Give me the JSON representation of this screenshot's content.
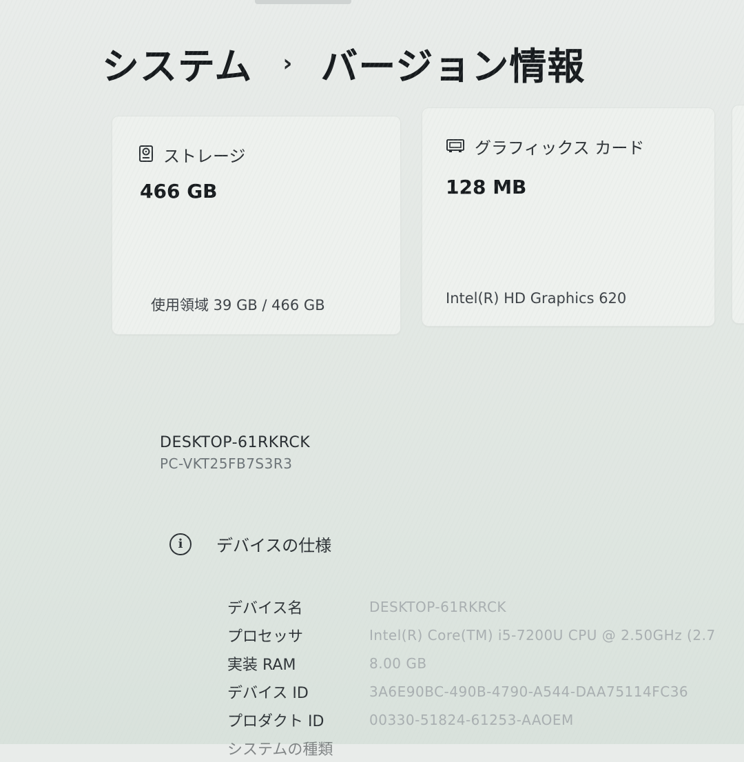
{
  "breadcrumb": {
    "parent": "システム",
    "separator": "›",
    "current": "バージョン情報"
  },
  "cards": {
    "storage": {
      "icon": "hard-drive-icon",
      "title": "ストレージ",
      "value": "466 GB",
      "sub": "使用領域 39 GB / 466 GB"
    },
    "graphics": {
      "icon": "graphics-card-icon",
      "title": "グラフィックス カード",
      "value": "128 MB",
      "sub": "Intel(R) HD Graphics 620"
    }
  },
  "device": {
    "name": "DESKTOP-61RKRCK",
    "model": "PC-VKT25FB7S3R3"
  },
  "specs": {
    "icon": "info-icon",
    "title": "デバイスの仕様",
    "rows": [
      {
        "label": "デバイス名",
        "value": "DESKTOP-61RKRCK"
      },
      {
        "label": "プロセッサ",
        "value": "Intel(R) Core(TM) i5-7200U CPU @ 2.50GHz (2.7"
      },
      {
        "label": "実装 RAM",
        "value": "8.00 GB"
      },
      {
        "label": "デバイス ID",
        "value": "3A6E90BC-490B-4790-A544-DAA75114FC36"
      },
      {
        "label": "プロダクト ID",
        "value": "00330-51824-61253-AAOEM"
      },
      {
        "label": "システムの種類",
        "value": ""
      }
    ]
  }
}
